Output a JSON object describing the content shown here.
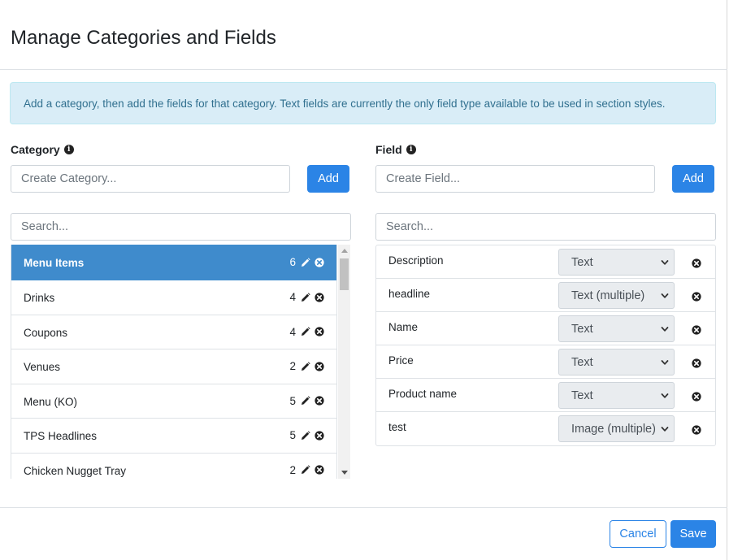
{
  "modal": {
    "title": "Manage Categories and Fields",
    "info_message": "Add a category, then add the fields for that category. Text fields are currently the only field type available to be used in section styles."
  },
  "category_panel": {
    "label": "Category",
    "create_placeholder": "Create Category...",
    "add_label": "Add",
    "search_placeholder": "Search...",
    "items": [
      {
        "name": "Menu Items",
        "count": "6",
        "active": true
      },
      {
        "name": "Drinks",
        "count": "4",
        "active": false
      },
      {
        "name": "Coupons",
        "count": "4",
        "active": false
      },
      {
        "name": "Venues",
        "count": "2",
        "active": false
      },
      {
        "name": "Menu (KO)",
        "count": "5",
        "active": false
      },
      {
        "name": "TPS Headlines",
        "count": "5",
        "active": false
      },
      {
        "name": "Chicken Nugget Tray",
        "count": "2",
        "active": false
      }
    ]
  },
  "field_panel": {
    "label": "Field",
    "create_placeholder": "Create Field...",
    "add_label": "Add",
    "search_placeholder": "Search...",
    "fields": [
      {
        "name": "Description",
        "type": "Text"
      },
      {
        "name": "headline",
        "type": "Text (multiple)"
      },
      {
        "name": "Name",
        "type": "Text"
      },
      {
        "name": "Price",
        "type": "Text"
      },
      {
        "name": "Product name",
        "type": "Text"
      },
      {
        "name": "test",
        "type": "Image (multiple)"
      }
    ]
  },
  "footer": {
    "cancel_label": "Cancel",
    "save_label": "Save"
  },
  "colors": {
    "primary": "#2b84e6",
    "active_item": "#3f8bcc",
    "alert_bg": "#d9edf7",
    "alert_text": "#31708f"
  },
  "icons": {
    "info": "info-circle-icon",
    "edit": "pencil-icon",
    "remove": "x-circle-icon",
    "select_arrow": "chevron-down-icon"
  }
}
